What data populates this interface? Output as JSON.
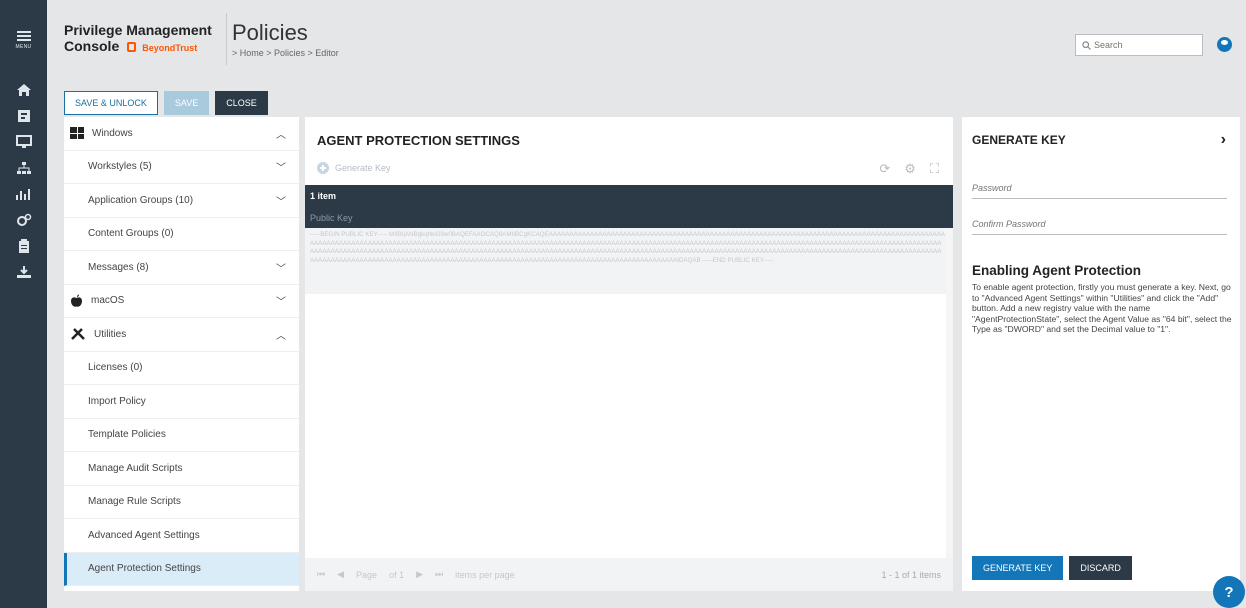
{
  "rail": {
    "menu_label": "MENU"
  },
  "header": {
    "brand_line1": "Privilege Management",
    "brand_line2": "Console",
    "brand_logo": "BeyondTrust",
    "title": "Policies",
    "breadcrumb": "> Home > Policies > Editor",
    "search_placeholder": "Search"
  },
  "toolbar": {
    "save_unlock": "SAVE & UNLOCK",
    "save": "SAVE",
    "close": "CLOSE"
  },
  "tree": {
    "windows": "Windows",
    "windows_items": [
      "Workstyles (5)",
      "Application Groups (10)",
      "Content Groups (0)",
      "Messages (8)"
    ],
    "macos": "macOS",
    "utilities": "Utilities",
    "utilities_items": [
      "Licenses (0)",
      "Import Policy",
      "Template Policies",
      "Manage Audit Scripts",
      "Manage Rule Scripts",
      "Advanced Agent Settings",
      "Agent Protection Settings"
    ]
  },
  "center": {
    "title": "AGENT PROTECTION SETTINGS",
    "generate_link": "Generate Key",
    "count": "1 item",
    "column": "Public Key",
    "key_text": "-----BEGIN PUBLIC KEY----- MIIBIjANBgkqhkiG9w0BAQEFAAOCAQ8AMIIBCgKCAQEAAAAAAAAAAAAAAAAAAAAAAAAAAAAAAAAAAAAAAAAAAAAAAAAAAAAAAAAAAAAAAAAAAAAAAAAAAAAAAAAAAAAAAAAAAAAAAAAAAAAAAAAAAAAAAAAAAAAAAAAAAAAAAAAAAAAAAAAAAAAAAAAAAAAAAAAAAAAAAAAAAAAAAAAAAAAAAAAAAAAAAAAAAAAAAAAAAAAAAAAAAAAAAAAAAAAAAAAAAAAAAAAAAAAAAAAAAAAAAAAAAAAAAAAAAAAAAAAAAAAAAAAAAAAAAAAAAAAAAAAAAAAAAAAAAAAAAAAAAAAAAAAAAAAAAAAAAAAAAAAAAAAAAAAAAAAAAAAAAAAAAAAAAAAAAAAAAAAAAAAAAAAAAAAAAAAAAAAAAAAAAAAAAAAAAAAAAAAAAAAAAAAAAAAAAAAAAAAAAAAAAAAAAAAAAAAAAAAAAAAAAAAAAAAAAAAAAAAAAAAAAAAAAAAAAAAAAAAAAAAAAAAAAAAAAAIDAQAB -----END PUBLIC KEY-----",
    "pager_page": "Page",
    "pager_of": "of 1",
    "pager_size": "items per page",
    "pager_range": "1 - 1 of 1 items"
  },
  "panel": {
    "title": "GENERATE KEY",
    "password_placeholder": "Password",
    "confirm_placeholder": "Confirm Password",
    "heading": "Enabling Agent Protection",
    "body": "To enable agent protection, firstly you must generate a key. Next, go to \"Advanced Agent Settings\" within \"Utilities\" and click the \"Add\" button. Add a new registry value with the name \"AgentProtectionState\", select the Agent Value as \"64 bit\", select the Type as \"DWORD\" and set the Decimal value to \"1\".",
    "generate_button": "GENERATE KEY",
    "discard_button": "DISCARD"
  },
  "help": "?",
  "colors": {
    "rail": "#2b3a46",
    "accent": "#1276b8",
    "brand": "#ff5500"
  }
}
